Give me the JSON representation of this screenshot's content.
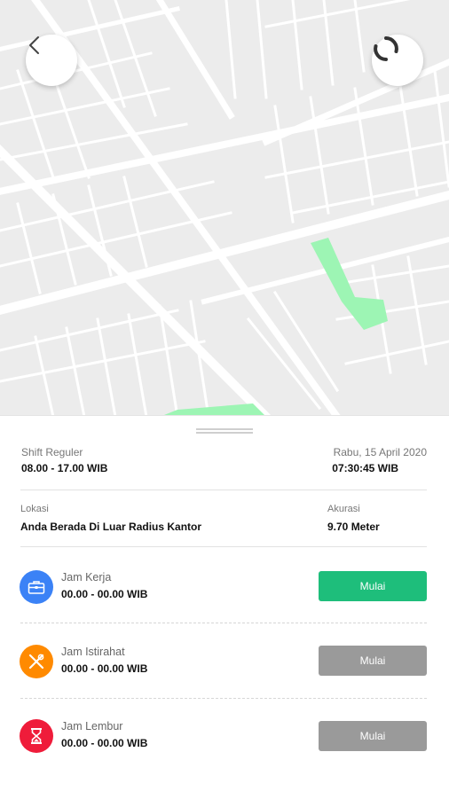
{
  "map": {
    "back_icon": "chevron-left-icon",
    "refresh_icon": "refresh-icon",
    "colors": {
      "background": "#ececec",
      "road": "#ffffff",
      "park": "#9df5b4"
    }
  },
  "shift": {
    "label": "Shift Reguler",
    "hours": "08.00 - 17.00 WIB",
    "date": "Rabu, 15 April 2020",
    "time": "07:30:45 WIB"
  },
  "location": {
    "label": "Lokasi",
    "value": "Anda Berada Di Luar Radius Kantor",
    "accuracy_label": "Akurasi",
    "accuracy_value": "9.70 Meter"
  },
  "rows": [
    {
      "title": "Jam Kerja",
      "time": "00.00 - 00.00 WIB",
      "button": "Mulai",
      "icon": "briefcase-icon",
      "icon_color": "#3b82f6",
      "button_color": "#1ebe7b",
      "enabled": true
    },
    {
      "title": "Jam Istirahat",
      "time": "00.00 - 00.00 WIB",
      "button": "Mulai",
      "icon": "fork-knife-icon",
      "icon_color": "#ff8a00",
      "button_color": "#9a9a9a",
      "enabled": false
    },
    {
      "title": "Jam Lembur",
      "time": "00.00 - 00.00 WIB",
      "button": "Mulai",
      "icon": "hourglass-icon",
      "icon_color": "#ef1c3a",
      "button_color": "#9a9a9a",
      "enabled": false
    }
  ]
}
